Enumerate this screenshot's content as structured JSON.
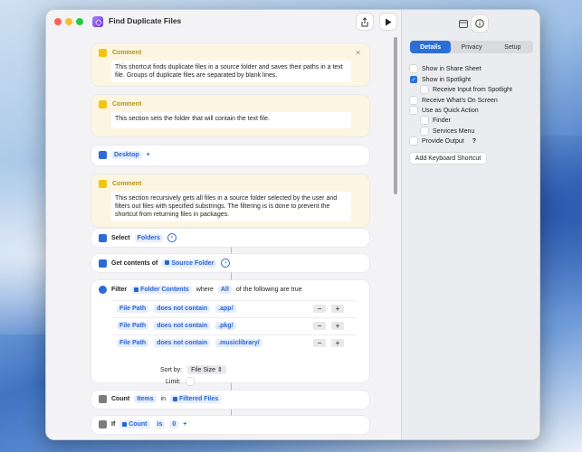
{
  "window": {
    "title": "Find Duplicate Files"
  },
  "colors": {
    "accent": "#2b6fd6",
    "comment_bg": "#fbf5e2",
    "comment_label": "#b7930d"
  },
  "actions": {
    "comment1": {
      "label": "Comment",
      "text": "This shortcut finds duplicate files in a source folder and saves their paths in a text file. Groups of duplicate files are separated by blank lines."
    },
    "comment2": {
      "label": "Comment",
      "text": "This section sets the folder that will contain the text file."
    },
    "folder": {
      "token": "Desktop",
      "plus": "+"
    },
    "comment3": {
      "label": "Comment",
      "text": "This section recursively gets all files in a source folder selected by the user and filters out files with specified substrings. The filtering is is done to prevent the shortcut from returning files in packages."
    },
    "select": {
      "label": "Select",
      "token": "Folders"
    },
    "get_contents": {
      "label": "Get contents of",
      "token": "Source Folder"
    },
    "filter": {
      "label": "Filter",
      "token": "Folder Contents",
      "where": "where",
      "all": "All",
      "suffix": "of the following are true",
      "rows": [
        {
          "field": "File Path",
          "op": "does not contain",
          "value": ".app/"
        },
        {
          "field": "File Path",
          "op": "does not contain",
          "value": ".pkg/"
        },
        {
          "field": "File Path",
          "op": "does not contain",
          "value": ".musiclibrary/"
        }
      ],
      "minus": "−",
      "plus": "+",
      "sort_label": "Sort by:",
      "sort_value": "File Size",
      "limit_label": "Limit:"
    },
    "count": {
      "label": "Count",
      "token": "Items",
      "in": "in",
      "token2": "Filtered Files"
    },
    "if": {
      "label": "If",
      "token": "Count",
      "op": "is",
      "value": "0",
      "plus": "+"
    }
  },
  "inspector": {
    "tabs": [
      "Details",
      "Privacy",
      "Setup"
    ],
    "active_tab": "Details",
    "options": [
      {
        "label": "Show in Share Sheet",
        "checked": false
      },
      {
        "label": "Show in Spotlight",
        "checked": true
      },
      {
        "label": "Receive Input from Spotlight",
        "checked": false
      },
      {
        "label": "Receive What's On Screen",
        "checked": false
      },
      {
        "label": "Use as Quick Action",
        "checked": false
      },
      {
        "label": "Finder",
        "checked": false
      },
      {
        "label": "Services Menu",
        "checked": false
      },
      {
        "label": "Provide Output",
        "checked": false
      }
    ],
    "help": "?",
    "keyboard_button": "Add Keyboard Shortcut"
  }
}
